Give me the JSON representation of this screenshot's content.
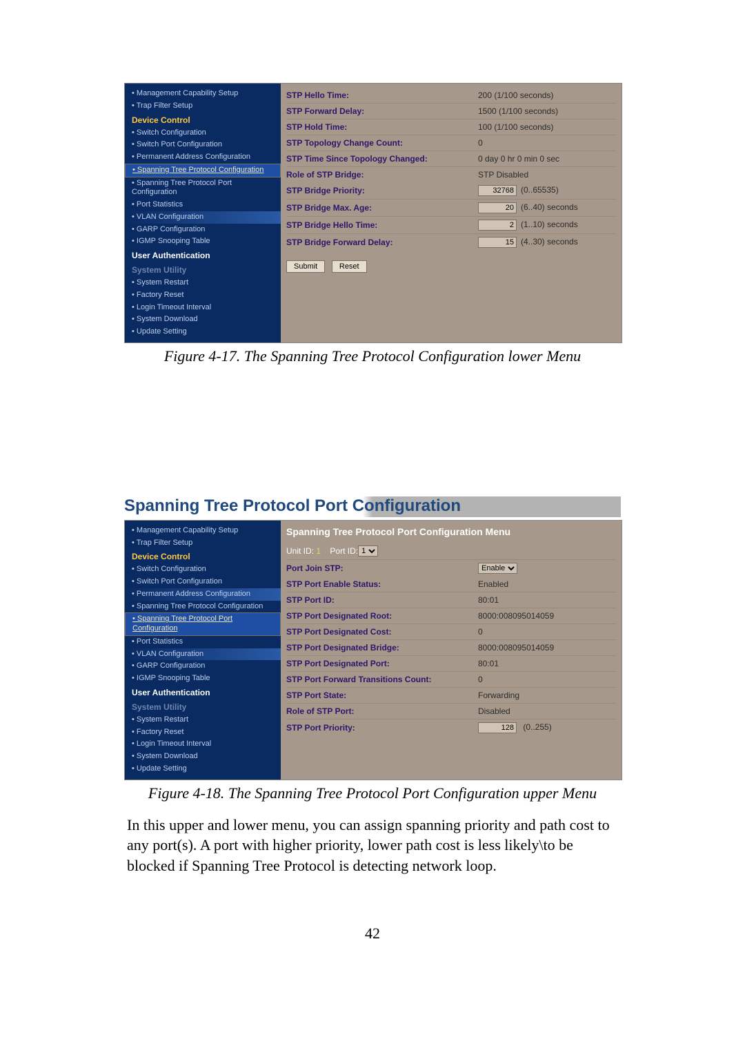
{
  "fig1": {
    "sidebar": {
      "items": [
        {
          "label": "Management Capability Setup",
          "type": "item"
        },
        {
          "label": "Trap Filter Setup",
          "type": "item"
        },
        {
          "label": "Device Control",
          "type": "grp"
        },
        {
          "label": "Switch Configuration",
          "type": "item"
        },
        {
          "label": "Switch Port Configuration",
          "type": "item"
        },
        {
          "label": "Permanent Address Configuration",
          "type": "item"
        },
        {
          "label": "Spanning Tree Protocol Configuration",
          "type": "item sel"
        },
        {
          "label": "Spanning Tree Protocol Port Configuration",
          "type": "item"
        },
        {
          "label": "Port Statistics",
          "type": "item"
        },
        {
          "label": "VLAN Configuration",
          "type": "item grad"
        },
        {
          "label": "GARP Configuration",
          "type": "item"
        },
        {
          "label": "IGMP Snooping Table",
          "type": "item"
        },
        {
          "label": "User Authentication",
          "type": "grp white"
        },
        {
          "label": "System Utility",
          "type": "grp dim"
        },
        {
          "label": "System Restart",
          "type": "item"
        },
        {
          "label": "Factory Reset",
          "type": "item"
        },
        {
          "label": "Login Timeout Interval",
          "type": "item"
        },
        {
          "label": "System Download",
          "type": "item"
        },
        {
          "label": "Update Setting",
          "type": "item"
        }
      ]
    },
    "rows": [
      {
        "label": "STP Hello Time:",
        "val": "200  (1/100 seconds)"
      },
      {
        "label": "STP Forward Delay:",
        "val": "1500  (1/100 seconds)"
      },
      {
        "label": "STP Hold Time:",
        "val": "100  (1/100 seconds)"
      },
      {
        "label": "STP Topology Change Count:",
        "val": "0"
      },
      {
        "label": "STP Time Since Topology Changed:",
        "val": "0 day 0 hr 0 min 0 sec"
      },
      {
        "label": "Role of STP Bridge:",
        "val": "STP Disabled"
      }
    ],
    "inputs": [
      {
        "label": "STP Bridge Priority:",
        "value": "32768",
        "hint": "(0..65535)"
      },
      {
        "label": "STP Bridge Max. Age:",
        "value": "20",
        "hint": "(6..40) seconds"
      },
      {
        "label": "STP Bridge Hello Time:",
        "value": "2",
        "hint": "(1..10) seconds"
      },
      {
        "label": "STP Bridge Forward Delay:",
        "value": "15",
        "hint": "(4..30) seconds"
      }
    ],
    "buttons": {
      "submit": "Submit",
      "reset": "Reset"
    },
    "caption": "Figure 4-17. The Spanning Tree Protocol Configuration lower Menu"
  },
  "section_heading": "Spanning Tree Protocol Port Configuration",
  "fig2": {
    "sidebar": {
      "items": [
        {
          "label": "Management Capability Setup",
          "type": "item"
        },
        {
          "label": "Trap Filter Setup",
          "type": "item"
        },
        {
          "label": "Device Control",
          "type": "grp"
        },
        {
          "label": "Switch Configuration",
          "type": "item"
        },
        {
          "label": "Switch Port Configuration",
          "type": "item"
        },
        {
          "label": "Permanent Address Configuration",
          "type": "item grad"
        },
        {
          "label": "Spanning Tree Protocol Configuration",
          "type": "item"
        },
        {
          "label": "Spanning Tree Protocol Port Configuration",
          "type": "item sel"
        },
        {
          "label": "Port Statistics",
          "type": "item"
        },
        {
          "label": "VLAN Configuration",
          "type": "item grad"
        },
        {
          "label": "GARP Configuration",
          "type": "item"
        },
        {
          "label": "IGMP Snooping Table",
          "type": "item"
        },
        {
          "label": "User Authentication",
          "type": "grp white"
        },
        {
          "label": "System Utility",
          "type": "grp dim"
        },
        {
          "label": "System Restart",
          "type": "item"
        },
        {
          "label": "Factory Reset",
          "type": "item"
        },
        {
          "label": "Login Timeout Interval",
          "type": "item"
        },
        {
          "label": "System Download",
          "type": "item"
        },
        {
          "label": "Update Setting",
          "type": "item"
        }
      ]
    },
    "title": "Spanning Tree Protocol Port Configuration Menu",
    "unit_label": "Unit ID:",
    "unit_val": "1",
    "port_label": "Port ID:",
    "port_val": "1",
    "join": {
      "label": "Port Join STP:",
      "value": "Enable"
    },
    "rows": [
      {
        "label": "STP Port Enable Status:",
        "val": "Enabled"
      },
      {
        "label": "STP Port ID:",
        "val": "80:01"
      },
      {
        "label": "STP Port Designated Root:",
        "val": "8000:008095014059"
      },
      {
        "label": "STP Port Designated Cost:",
        "val": "0"
      },
      {
        "label": "STP Port Designated Bridge:",
        "val": "8000:008095014059"
      },
      {
        "label": "STP Port Designated Port:",
        "val": "80:01"
      },
      {
        "label": "STP Port Forward Transitions Count:",
        "val": "0"
      },
      {
        "label": "STP Port State:",
        "val": "Forwarding"
      },
      {
        "label": "Role of STP Port:",
        "val": "Disabled"
      }
    ],
    "priority": {
      "label": "STP Port Priority:",
      "value": "128",
      "hint": "(0..255)"
    },
    "caption": "Figure 4-18. The Spanning Tree Protocol Port Configuration upper Menu"
  },
  "body_text": "In this upper and lower menu, you can assign spanning priority and path cost to any port(s). A port with higher priority, lower path cost is less likely\\to be blocked if Spanning Tree Protocol is detecting network loop.",
  "page_number": "42"
}
